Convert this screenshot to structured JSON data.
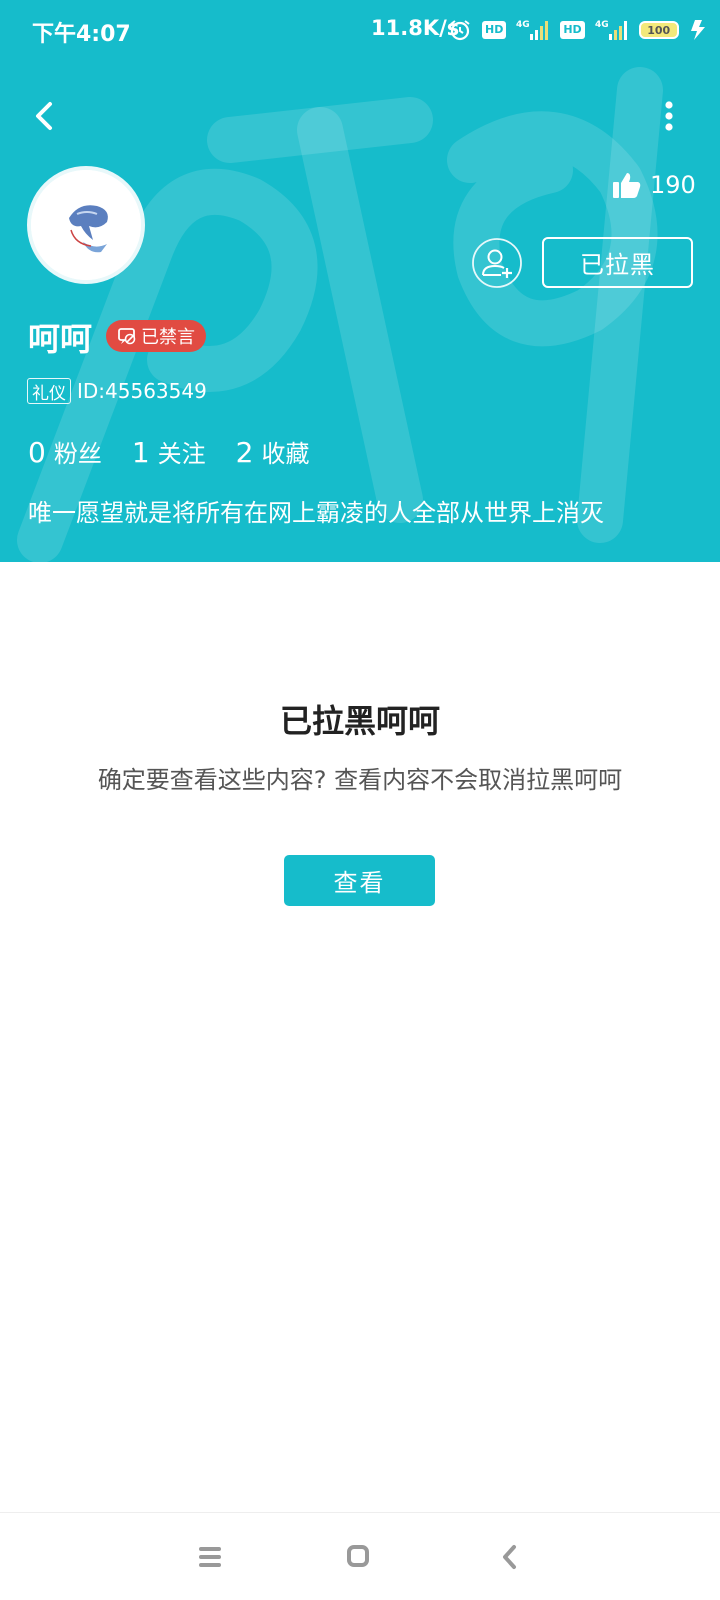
{
  "status_bar": {
    "time": "下午4:07",
    "net_speed": "11.8K/s",
    "hd1": "HD",
    "hd2": "HD",
    "battery": "100",
    "icons": [
      "alarm-icon",
      "hd-icon",
      "signal-4g-icon",
      "hd-icon",
      "signal-4g-icon",
      "battery-icon",
      "charging-icon"
    ]
  },
  "toolbar": {
    "back_icon": "chevron-left-icon",
    "more_icon": "more-vertical-icon"
  },
  "profile": {
    "likes_count": "190",
    "blocked_button_label": "已拉黑",
    "username": "呵呵",
    "muted_badge": "已禁言",
    "etiquette_badge": "礼仪",
    "user_id": "ID:45563549",
    "stats": [
      {
        "value": "0",
        "label": "粉丝"
      },
      {
        "value": "1",
        "label": "关注"
      },
      {
        "value": "2",
        "label": "收藏"
      }
    ],
    "bio": "唯一愿望就是将所有在网上霸凌的人全部从世界上消灭"
  },
  "block_notice": {
    "title": "已拉黑呵呵",
    "description": "确定要查看这些内容? 查看内容不会取消拉黑呵呵",
    "view_button_label": "查看"
  },
  "colors": {
    "header_bg": "#16bccb",
    "accent": "#16bccb",
    "muted_badge_bg": "#e14b42"
  }
}
